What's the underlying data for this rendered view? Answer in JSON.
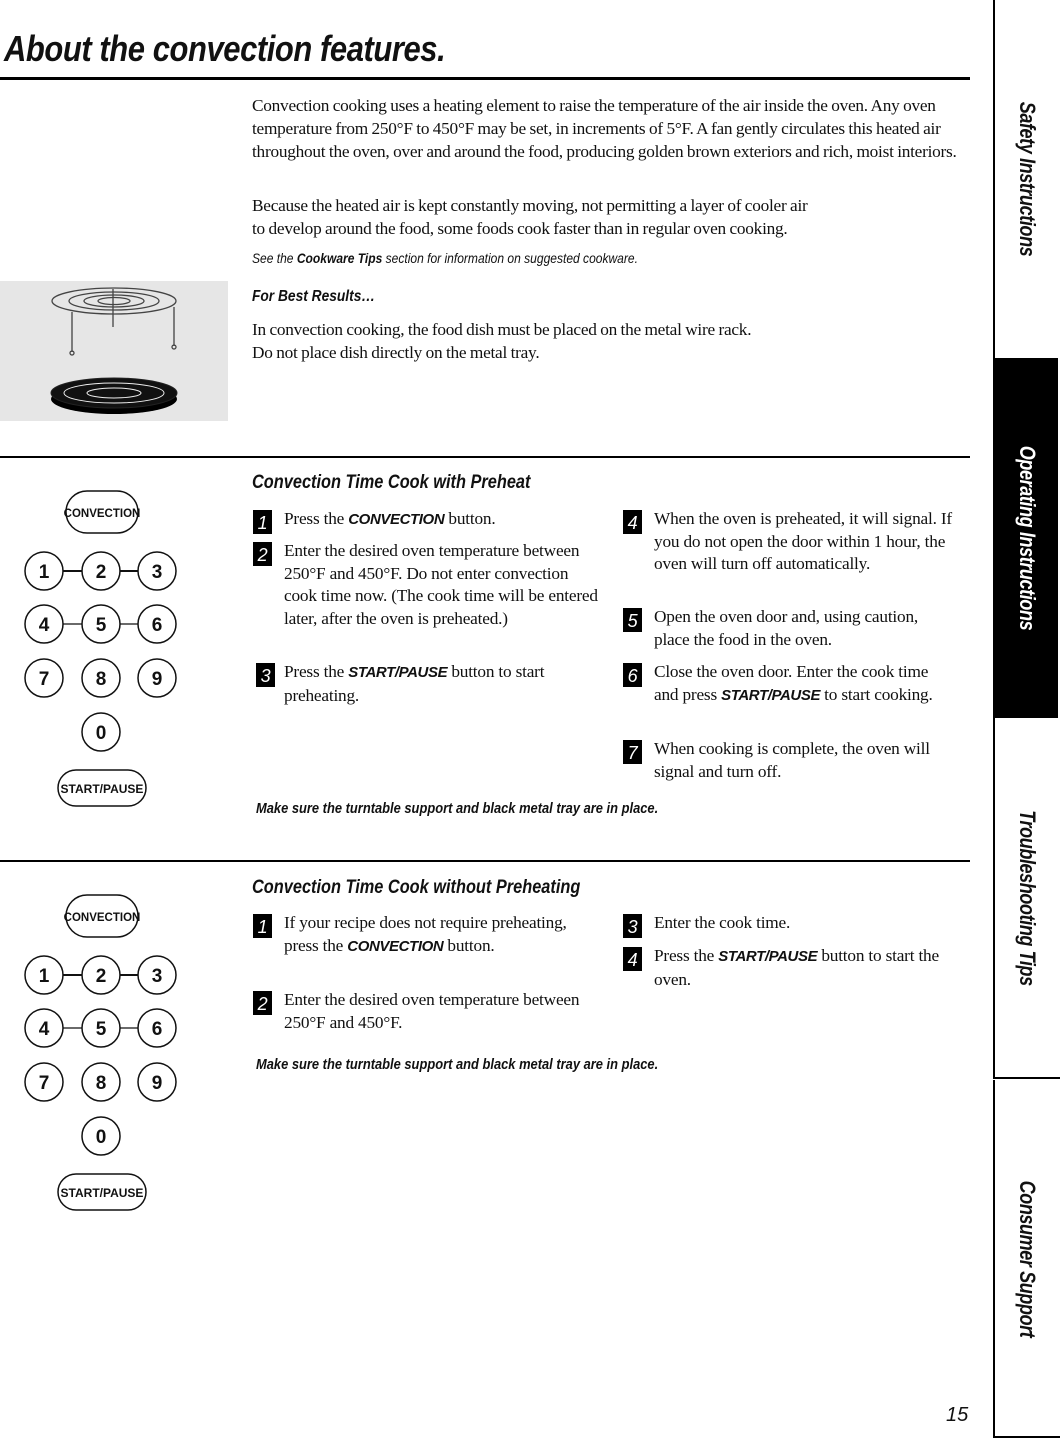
{
  "page": {
    "title": "About the convection features.",
    "page_number": "15"
  },
  "side_tabs": [
    {
      "label": "Safety Instructions",
      "active": false
    },
    {
      "label": "Operating Instructions",
      "active": true
    },
    {
      "label": "Troubleshooting Tips",
      "active": false
    },
    {
      "label": "Consumer Support",
      "active": false
    }
  ],
  "intro": {
    "paragraph_1": "Convection cooking uses a heating element to raise the temperature of the air inside the oven. Any oven temperature from 250°F to 450°F may be set, in increments of 5°F. A fan gently circulates this heated air throughout the oven, over and around the food, producing golden brown exteriors and rich, moist interiors.",
    "paragraph_2_line_1": "Because the heated air is kept constantly moving, not permitting a layer of cooler air",
    "paragraph_2_line_2": "to develop around the food, some foods cook faster than in regular oven cooking.",
    "see_note_prefix": "See the ",
    "see_note_link": "Cookware Tips",
    "see_note_suffix": " section for information on suggested cookware."
  },
  "best_results": {
    "heading": "For Best Results…",
    "line_1": "In convection cooking, the food dish must be placed on the metal wire rack.",
    "line_2": "Do not place dish directly on the metal tray.",
    "figure": "wire-rack-and-metal-tray-illustration"
  },
  "keypad": {
    "convection_label": "CONVECTION",
    "start_pause_label": "START/PAUSE",
    "digits": [
      "1",
      "2",
      "3",
      "4",
      "5",
      "6",
      "7",
      "8",
      "9",
      "0"
    ]
  },
  "section_preheat": {
    "heading": "Convection Time Cook with Preheat",
    "steps": [
      {
        "num": "1",
        "pre": "Press the ",
        "kw": "CONVECTION",
        "post": " button."
      },
      {
        "num": "2",
        "pre": "Enter the desired oven temperature between 250°F and 450°F. Do not enter convection cook time now. (The cook time will be entered later, after the oven is preheated.)",
        "kw": "",
        "post": ""
      },
      {
        "num": "3",
        "pre": "Press the ",
        "kw": "START/PAUSE",
        "post": " button to start preheating."
      },
      {
        "num": "4",
        "pre": "When the oven is preheated, it will signal. If you do not open the door within 1 hour, the oven will turn off automatically.",
        "kw": "",
        "post": ""
      },
      {
        "num": "5",
        "pre": "Open the oven door and, using caution, place the food in the oven.",
        "kw": "",
        "post": ""
      },
      {
        "num": "6",
        "pre": "Close the oven door. Enter the cook time and press ",
        "kw": "START/PAUSE",
        "post": " to start cooking."
      },
      {
        "num": "7",
        "pre": "When cooking is complete, the oven will signal and turn off.",
        "kw": "",
        "post": ""
      }
    ],
    "note": "Make sure the turntable support and black metal tray are in place."
  },
  "section_no_preheat": {
    "heading": "Convection Time Cook without Preheating",
    "steps": [
      {
        "num": "1",
        "pre": "If your recipe does not require preheating, press the ",
        "kw": "CONVECTION",
        "post": " button."
      },
      {
        "num": "2",
        "pre": "Enter the desired oven temperature between 250°F and 450°F.",
        "kw": "",
        "post": ""
      },
      {
        "num": "3",
        "pre": "Enter the cook time.",
        "kw": "",
        "post": ""
      },
      {
        "num": "4",
        "pre": "Press the ",
        "kw": "START/PAUSE",
        "post": " button to start the oven."
      }
    ],
    "note": "Make sure the turntable support and black metal tray are in place."
  }
}
